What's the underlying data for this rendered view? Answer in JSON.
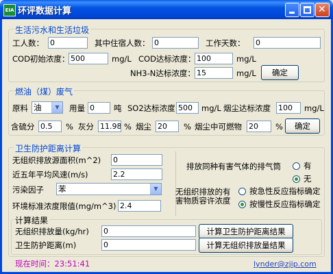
{
  "window": {
    "title": "环评数据计算",
    "icon_text": "EIA"
  },
  "sewage": {
    "title": "生活污水和生活垃圾",
    "workers_label": "工人数：",
    "workers_value": "0",
    "residents_label": "其中住宿人数：",
    "residents_value": "0",
    "workdays_label": "工作天数：",
    "workdays_value": "0",
    "cod_initial_label": "COD初始浓度：",
    "cod_initial_value": "500",
    "cod_initial_unit": "mg/L",
    "cod_standard_label": "COD达标浓度：",
    "cod_standard_value": "100",
    "cod_standard_unit": "mg/L",
    "nh3_label": "NH3-N达标浓度：",
    "nh3_value": "15",
    "nh3_unit": "mg/L",
    "confirm_label": "确定"
  },
  "fuel": {
    "title": "燃油（煤）废气",
    "material_label": "原料",
    "material_value": "油",
    "usage_label": "用量",
    "usage_value": "0",
    "usage_unit": "吨",
    "so2_label": "SO2达标浓度",
    "so2_value": "500",
    "so2_unit": "mg/L",
    "smoke_label": "烟尘达标浓度",
    "smoke_value": "100",
    "smoke_unit": "mg/L",
    "sulfur_label": "含硫分",
    "sulfur_value": "0.5",
    "sulfur_unit": "%",
    "ash_label": "灰分",
    "ash_value": "11.98",
    "ash_unit": "%",
    "dust_label": "烟尘",
    "dust_value": "20",
    "dust_unit": "%",
    "combustible_label": "烟尘中可燃物",
    "combustible_value": "20",
    "combustible_unit": "%",
    "confirm_label": "确定"
  },
  "distance": {
    "title": "卫生防护距离计算",
    "area_label": "无组织排放源面积(m^2)",
    "area_value": "0",
    "wind_label": "近五年平均风速(m/s)",
    "wind_value": "2.2",
    "pollutant_label": "污染因子",
    "pollutant_value": "苯",
    "limit_label": "环境标准浓度限值(mg/m^3)",
    "limit_value": "2.4",
    "stack_label": "排放同种有害气体的排气筒",
    "stack_yes": "有",
    "stack_no": "无",
    "allow_label_1": "无组织排放的有",
    "allow_label_2": "害物质容许浓度",
    "acute_label": "按急性反应指标确定",
    "chronic_label": "按慢性反应指标确定",
    "result_title": "计算结果",
    "emission_label": "无组织排放量(kg/hr)",
    "emission_value": "0",
    "protect_label": "卫生防护距离(m)",
    "protect_value": "0",
    "calc_distance_label": "计算卫生防护距离结果",
    "calc_emission_label": "计算无组织排放量结果"
  },
  "status": {
    "time_label": "现在时间：23:51:41",
    "email": "lynder@zjip.com"
  },
  "colors": {
    "group_title": "#0046d5",
    "titlebar": "#0054e3",
    "status_time": "#c000c0"
  }
}
